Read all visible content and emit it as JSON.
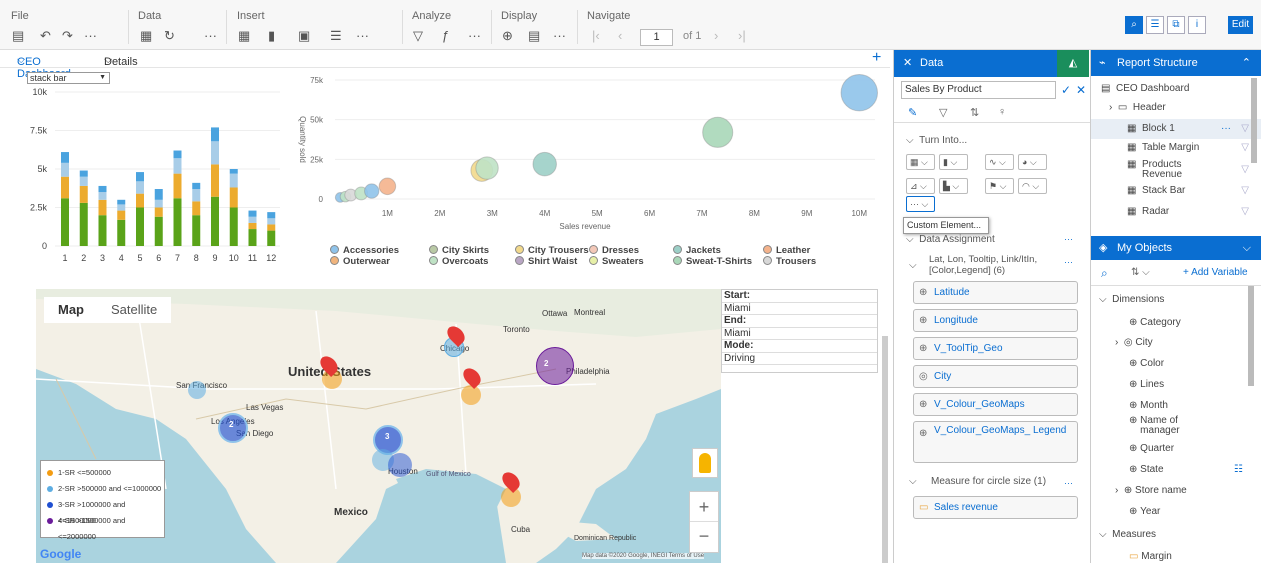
{
  "toolbar": {
    "groups": [
      "File",
      "Data",
      "Insert",
      "Analyze",
      "Display",
      "Navigate"
    ],
    "page_value": "1",
    "page_of": "of 1",
    "edit_label": "Edit"
  },
  "tabs": {
    "dashboard": "CEO Dashboard",
    "details": "Details"
  },
  "stack_chart": {
    "select_value": "stack bar",
    "y_ticks": [
      "10k",
      "7.5k",
      "5k",
      "2.5k",
      "0"
    ],
    "x_ticks": [
      "1",
      "2",
      "3",
      "4",
      "5",
      "6",
      "7",
      "8",
      "9",
      "10",
      "11",
      "12"
    ]
  },
  "bubble_chart": {
    "ylabel": "Quantity sold",
    "xlabel": "Sales revenue",
    "y_ticks": [
      "75k",
      "50k",
      "25k",
      "0"
    ],
    "x_ticks": [
      "1M",
      "2M",
      "3M",
      "4M",
      "5M",
      "6M",
      "7M",
      "8M",
      "9M",
      "10M"
    ],
    "legend": [
      {
        "name": "Accessories",
        "color": "#8fc3ea"
      },
      {
        "name": "City Skirts",
        "color": "#b9c9a5"
      },
      {
        "name": "City Trousers",
        "color": "#f2d98c"
      },
      {
        "name": "Dresses",
        "color": "#f3c8b8"
      },
      {
        "name": "Jackets",
        "color": "#9ccfc7"
      },
      {
        "name": "Leather",
        "color": "#f4b38c"
      },
      {
        "name": "Outerwear",
        "color": "#f0b47d"
      },
      {
        "name": "Overcoats",
        "color": "#bfe2c5"
      },
      {
        "name": "Shirt Waist",
        "color": "#b9a6c4"
      },
      {
        "name": "Sweaters",
        "color": "#e7f0a8"
      },
      {
        "name": "Sweat-T-Shirts",
        "color": "#a9d7b8"
      },
      {
        "name": "Trousers",
        "color": "#d8d8d8"
      }
    ]
  },
  "chart_data": [
    {
      "type": "bar",
      "categories": [
        "1",
        "2",
        "3",
        "4",
        "5",
        "6",
        "7",
        "8",
        "9",
        "10",
        "11",
        "12"
      ],
      "ylim": [
        0,
        10000
      ],
      "series": [
        {
          "color": "#5aa319",
          "values": [
            3100,
            2800,
            2000,
            1700,
            2500,
            1900,
            3100,
            2000,
            3200,
            2500,
            1100,
            1000
          ]
        },
        {
          "color": "#ecab2e",
          "values": [
            1400,
            1100,
            1000,
            600,
            900,
            600,
            1600,
            900,
            2100,
            1300,
            400,
            400
          ]
        },
        {
          "color": "#a8cde8",
          "values": [
            900,
            600,
            500,
            400,
            800,
            500,
            1000,
            800,
            1500,
            900,
            400,
            400
          ]
        },
        {
          "color": "#4aa3df",
          "values": [
            700,
            400,
            400,
            300,
            600,
            700,
            500,
            400,
            900,
            300,
            400,
            400
          ]
        }
      ]
    },
    {
      "type": "scatter",
      "xlabel": "Sales revenue",
      "ylabel": "Quantity sold",
      "xlim": [
        0,
        10300000
      ],
      "ylim": [
        0,
        75000
      ],
      "points": [
        {
          "x": 100000,
          "y": 1000,
          "color": "#8fc3ea"
        },
        {
          "x": 200000,
          "y": 1500,
          "color": "#bfe2c5"
        },
        {
          "x": 300000,
          "y": 2500,
          "color": "#d8d8d8"
        },
        {
          "x": 500000,
          "y": 3500,
          "color": "#bfe2c5"
        },
        {
          "x": 700000,
          "y": 5000,
          "color": "#8fc3ea"
        },
        {
          "x": 1000000,
          "y": 8000,
          "color": "#f4b38c"
        },
        {
          "x": 2800000,
          "y": 18000,
          "color": "#f2d98c"
        },
        {
          "x": 2900000,
          "y": 19500,
          "color": "#bfe2c5"
        },
        {
          "x": 4000000,
          "y": 22000,
          "color": "#9ccfc7"
        },
        {
          "x": 7300000,
          "y": 42000,
          "color": "#a9d7b8"
        },
        {
          "x": 10000000,
          "y": 67000,
          "color": "#8fc3ea"
        }
      ]
    }
  ],
  "map": {
    "tab_map": "Map",
    "tab_satellite": "Satellite",
    "labels": [
      "United States",
      "Mexico",
      "Cuba",
      "San Francisco",
      "Las Vegas",
      "Los Angeles",
      "San Diego",
      "Chicago",
      "Toronto",
      "Ottawa",
      "Montreal",
      "Philadelphia",
      "Houston",
      "Dominican Republic",
      "Gulf of Mexico"
    ],
    "legend": [
      {
        "label": "1-SR <=500000",
        "color": "#f39c12"
      },
      {
        "label": "2-SR >500000 and <=1000000",
        "color": "#5dade2"
      },
      {
        "label": "3-SR >1000000 and <=1500000",
        "color": "#1f4fd1"
      },
      {
        "label": "4-SR >1500000 and <=2000000",
        "color": "#6a1b9a"
      }
    ],
    "footer": "Map data ©2020 Google, INEGI   Terms of Use",
    "google": "Google"
  },
  "route": {
    "start_label": "Start:",
    "start": "Miami",
    "end_label": "End:",
    "end": "Miami",
    "mode_label": "Mode:",
    "mode": "Driving"
  },
  "data_panel": {
    "title": "Data",
    "name_value": "Sales By Product",
    "turn_into": "Turn Into...",
    "custom_tooltip": "Custom Element...",
    "data_assignment": "Data Assignment",
    "lat_group": "Lat, Lon, Tooltip, Link/ItIn, [Color,Legend] (6)",
    "fields": [
      "Latitude",
      "Longitude",
      "V_ToolTip_Geo",
      "City",
      "V_Colour_GeoMaps",
      "V_Colour_GeoMaps_ Legend"
    ],
    "measure_group": "Measure for circle size (1)",
    "measure_field": "Sales revenue"
  },
  "report_structure": {
    "title": "Report Structure",
    "items": [
      "CEO Dashboard",
      "Header",
      "Block 1",
      "Table Margin",
      "Products Revenue",
      "Stack Bar",
      "Radar"
    ]
  },
  "my_objects": {
    "title": "My Objects",
    "add_variable": "Add Variable",
    "dimensions_label": "Dimensions",
    "dimensions": [
      "Category",
      "City",
      "Color",
      "Lines",
      "Month",
      "Name of manager",
      "Quarter",
      "State",
      "Store name",
      "Year"
    ],
    "measures_label": "Measures",
    "measures": [
      "Margin"
    ]
  }
}
